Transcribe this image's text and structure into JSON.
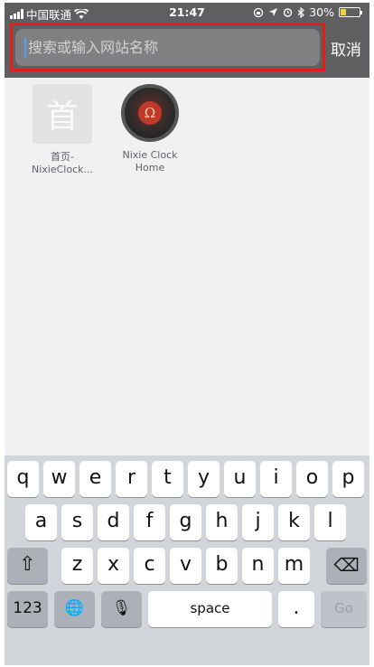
{
  "status_bar": {
    "carrier": "中国联通",
    "time": "21:47",
    "battery": "30%",
    "battery_level": 0.3
  },
  "search": {
    "placeholder": "搜索或输入网站名称",
    "cancel_label": "取消"
  },
  "bookmarks": [
    {
      "tile_text": "首",
      "label_line1": "首页-",
      "label_line2": "NixieClock..."
    },
    {
      "icon": "nixie-clock-app-icon",
      "icon_glyph": "Ω",
      "label_line1": "Nixie Clock",
      "label_line2": "Home"
    }
  ],
  "keyboard": {
    "row1": [
      "q",
      "w",
      "e",
      "r",
      "t",
      "y",
      "u",
      "i",
      "o",
      "p"
    ],
    "row2": [
      "a",
      "s",
      "d",
      "f",
      "g",
      "h",
      "j",
      "k",
      "l"
    ],
    "row3": [
      "z",
      "x",
      "c",
      "v",
      "b",
      "n",
      "m"
    ],
    "shift_glyph": "⇧",
    "delete_glyph": "⌫",
    "numbers_label": "123",
    "globe_glyph": "🌐",
    "mic_glyph": "🎙",
    "space_label": "space",
    "period_label": ".",
    "go_label": "Go"
  }
}
